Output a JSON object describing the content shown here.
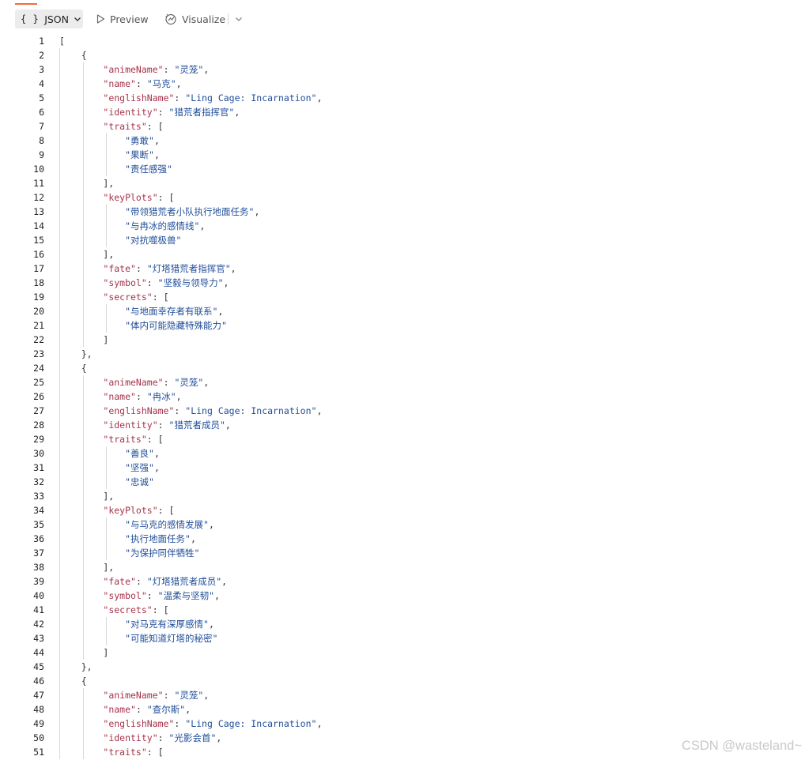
{
  "toolbar": {
    "json_braces": "{ }",
    "json_label": "JSON",
    "preview_label": "Preview",
    "visualize_label": "Visualize"
  },
  "editor": {
    "lines": [
      {
        "n": "1",
        "t": "["
      },
      {
        "n": "2",
        "t": "    {"
      },
      {
        "n": "3",
        "t": "        \"animeName\": \"灵笼\","
      },
      {
        "n": "4",
        "t": "        \"name\": \"马克\","
      },
      {
        "n": "5",
        "t": "        \"englishName\": \"Ling Cage: Incarnation\","
      },
      {
        "n": "6",
        "t": "        \"identity\": \"猎荒者指挥官\","
      },
      {
        "n": "7",
        "t": "        \"traits\": ["
      },
      {
        "n": "8",
        "t": "            \"勇敢\","
      },
      {
        "n": "9",
        "t": "            \"果断\","
      },
      {
        "n": "10",
        "t": "            \"责任感强\""
      },
      {
        "n": "11",
        "t": "        ],"
      },
      {
        "n": "12",
        "t": "        \"keyPlots\": ["
      },
      {
        "n": "13",
        "t": "            \"带领猎荒者小队执行地面任务\","
      },
      {
        "n": "14",
        "t": "            \"与冉冰的感情线\","
      },
      {
        "n": "15",
        "t": "            \"对抗噬极兽\""
      },
      {
        "n": "16",
        "t": "        ],"
      },
      {
        "n": "17",
        "t": "        \"fate\": \"灯塔猎荒者指挥官\","
      },
      {
        "n": "18",
        "t": "        \"symbol\": \"坚毅与领导力\","
      },
      {
        "n": "19",
        "t": "        \"secrets\": ["
      },
      {
        "n": "20",
        "t": "            \"与地面幸存者有联系\","
      },
      {
        "n": "21",
        "t": "            \"体内可能隐藏特殊能力\""
      },
      {
        "n": "22",
        "t": "        ]"
      },
      {
        "n": "23",
        "t": "    },"
      },
      {
        "n": "24",
        "t": "    {"
      },
      {
        "n": "25",
        "t": "        \"animeName\": \"灵笼\","
      },
      {
        "n": "26",
        "t": "        \"name\": \"冉冰\","
      },
      {
        "n": "27",
        "t": "        \"englishName\": \"Ling Cage: Incarnation\","
      },
      {
        "n": "28",
        "t": "        \"identity\": \"猎荒者成员\","
      },
      {
        "n": "29",
        "t": "        \"traits\": ["
      },
      {
        "n": "30",
        "t": "            \"善良\","
      },
      {
        "n": "31",
        "t": "            \"坚强\","
      },
      {
        "n": "32",
        "t": "            \"忠诚\""
      },
      {
        "n": "33",
        "t": "        ],"
      },
      {
        "n": "34",
        "t": "        \"keyPlots\": ["
      },
      {
        "n": "35",
        "t": "            \"与马克的感情发展\","
      },
      {
        "n": "36",
        "t": "            \"执行地面任务\","
      },
      {
        "n": "37",
        "t": "            \"为保护同伴牺牲\""
      },
      {
        "n": "38",
        "t": "        ],"
      },
      {
        "n": "39",
        "t": "        \"fate\": \"灯塔猎荒者成员\","
      },
      {
        "n": "40",
        "t": "        \"symbol\": \"温柔与坚韧\","
      },
      {
        "n": "41",
        "t": "        \"secrets\": ["
      },
      {
        "n": "42",
        "t": "            \"对马克有深厚感情\","
      },
      {
        "n": "43",
        "t": "            \"可能知道灯塔的秘密\""
      },
      {
        "n": "44",
        "t": "        ]"
      },
      {
        "n": "45",
        "t": "    },"
      },
      {
        "n": "46",
        "t": "    {"
      },
      {
        "n": "47",
        "t": "        \"animeName\": \"灵笼\","
      },
      {
        "n": "48",
        "t": "        \"name\": \"查尔斯\","
      },
      {
        "n": "49",
        "t": "        \"englishName\": \"Ling Cage: Incarnation\","
      },
      {
        "n": "50",
        "t": "        \"identity\": \"光影会首\","
      },
      {
        "n": "51",
        "t": "        \"traits\": ["
      }
    ]
  },
  "colors": {
    "key": "#a6334a",
    "string": "#1f4d99",
    "punct": "#333333",
    "accent": "#f26b3a"
  },
  "watermark": "CSDN @wasteland~"
}
